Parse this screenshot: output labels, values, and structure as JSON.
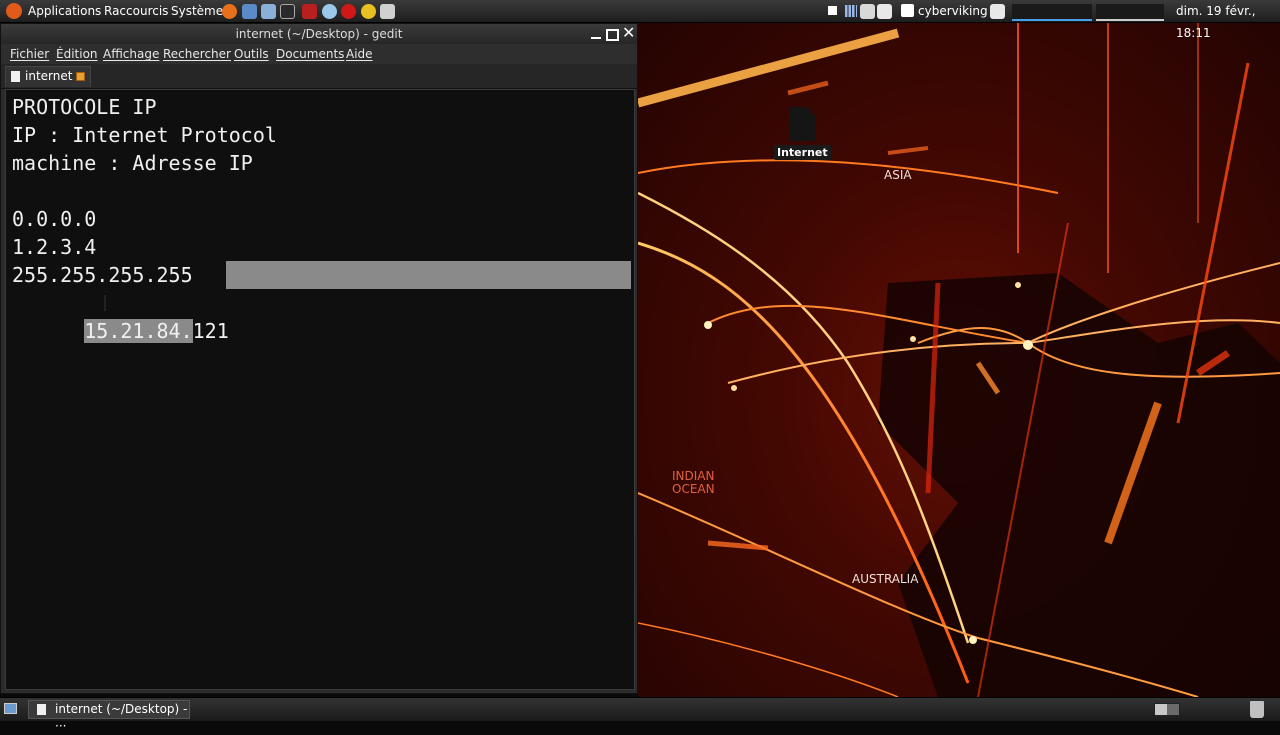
{
  "top_panel": {
    "menus": [
      "Applications",
      "Raccourcis",
      "Système"
    ],
    "username": "cyberviking",
    "clock": "dim. 19 févr., 18:11"
  },
  "window": {
    "title": "internet (~/Desktop) - gedit",
    "menu": [
      "Fichier",
      "Édition",
      "Affichage",
      "Rechercher",
      "Outils",
      "Documents",
      "Aide"
    ],
    "tab_label": "internet"
  },
  "editor": {
    "lines": [
      "PROTOCOLE IP",
      "IP : Internet Protocol",
      "machine : Adresse IP",
      "",
      "0.0.0.0",
      "1.2.3.4",
      "255.255.255.255",
      "15.21.84.121"
    ],
    "selection_start": "15.21.84.",
    "selection_rest": "121"
  },
  "desktop": {
    "icon_label": "Internet",
    "map_labels": [
      "ASIA",
      "INDIAN\nOCEAN",
      "AUSTRALIA"
    ]
  },
  "taskbar": {
    "window_button": "internet (~/Desktop) - ···"
  },
  "colors": {
    "panel": "#262626",
    "selection": "#8a8a8a",
    "wallpaper_accent": "#ff6a1a"
  }
}
